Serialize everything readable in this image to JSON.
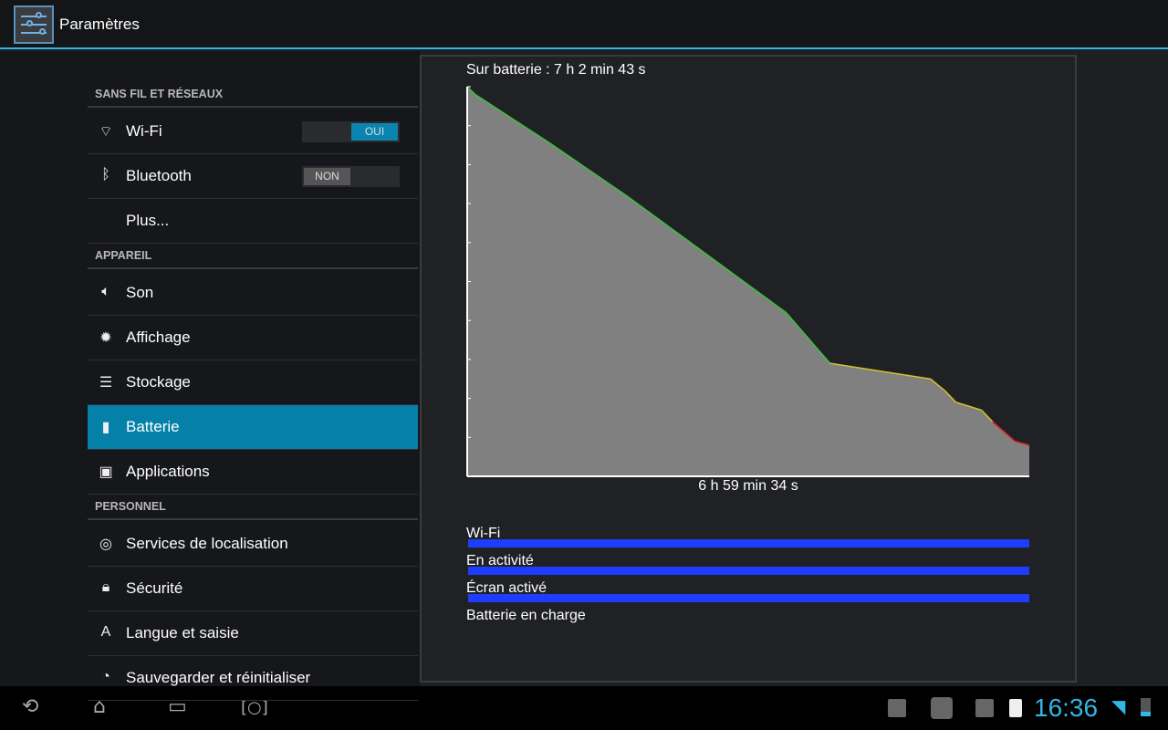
{
  "title": "Paramètres",
  "sections": [
    {
      "header": "SANS FIL ET RÉSEAUX",
      "items": [
        {
          "label": "Wi-Fi",
          "icon": "wifi-icon",
          "toggle": "OUI",
          "on": true
        },
        {
          "label": "Bluetooth",
          "icon": "bluetooth-icon",
          "toggle": "NON",
          "on": false
        },
        {
          "label": "Plus...",
          "icon": ""
        }
      ]
    },
    {
      "header": "APPAREIL",
      "items": [
        {
          "label": "Son",
          "icon": "speaker-icon"
        },
        {
          "label": "Affichage",
          "icon": "brightness-icon"
        },
        {
          "label": "Stockage",
          "icon": "storage-icon"
        },
        {
          "label": "Batterie",
          "icon": "battery-icon",
          "selected": true
        },
        {
          "label": "Applications",
          "icon": "apps-icon"
        }
      ]
    },
    {
      "header": "PERSONNEL",
      "items": [
        {
          "label": "Services de localisation",
          "icon": "location-icon"
        },
        {
          "label": "Sécurité",
          "icon": "lock-icon"
        },
        {
          "label": "Langue et saisie",
          "icon": "language-icon"
        },
        {
          "label": "Sauvegarder et réinitialiser",
          "icon": "backup-icon"
        }
      ]
    }
  ],
  "battery": {
    "on_battery": "Sur batterie : 7 h 2 min 43 s",
    "duration_label": "6 h 59 min 34 s",
    "activities": [
      {
        "label": "Wi-Fi",
        "active_fraction": 1
      },
      {
        "label": "En activité",
        "active_fraction": 1
      },
      {
        "label": "Écran activé",
        "active_fraction": 1
      },
      {
        "label": "Batterie en charge",
        "active_fraction": 0
      }
    ],
    "bar_color": "#1f3dff"
  },
  "chart_data": {
    "type": "area",
    "xlabel": "6 h 59 min 34 s",
    "ylim": [
      0,
      100
    ],
    "xlim_hours": [
      0,
      7.05
    ],
    "y_ticks": [
      0,
      10,
      20,
      30,
      40,
      50,
      60,
      70,
      80,
      90,
      100
    ],
    "x_hours": [
      0,
      0.1,
      1,
      2,
      3,
      4,
      4.55,
      5.81,
      5.99,
      6.13,
      6.29,
      6.45,
      6.59,
      6.87,
      7.05
    ],
    "level_percent": [
      100,
      98,
      86,
      72,
      57,
      42,
      29,
      25,
      22,
      19,
      18,
      17,
      14,
      9,
      8
    ],
    "colors": {
      "high": "#3ac33a",
      "medium": "#d4c22a",
      "low": "#e02020",
      "fill": "#808080"
    }
  },
  "status": {
    "time": "16:36"
  }
}
